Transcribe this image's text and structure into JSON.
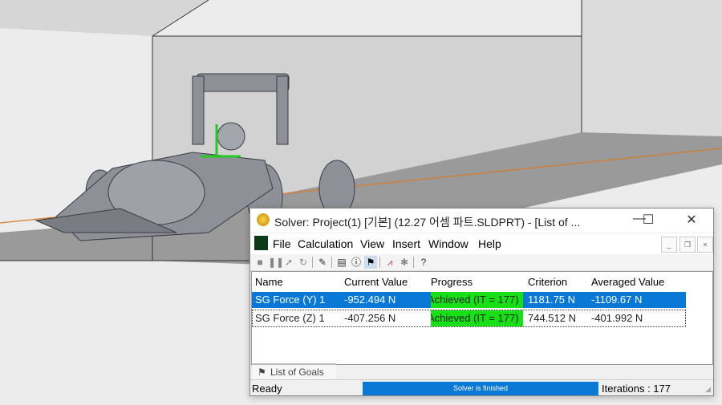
{
  "window": {
    "title": "Solver: Project(1) [기본] (12.27 어셈 파트.SLDPRT) - [List of ...",
    "minimize": "—",
    "maximize": "☐",
    "close": "✕"
  },
  "menu": [
    "File",
    "Calculation",
    "View",
    "Insert",
    "Window",
    "Help"
  ],
  "mdi": {
    "minimize": "_",
    "restore": "❐",
    "close": "×"
  },
  "toolbar": [
    "stop-icon",
    "pause-icon",
    "solve-icon",
    "refresh-icon",
    "pin-icon",
    "document-icon",
    "info-icon",
    "goals-flag-icon",
    "plot-icon",
    "probe-icon",
    "help-icon"
  ],
  "table": {
    "columns": [
      "Name",
      "Current Value",
      "Progress",
      "Criterion",
      "Averaged Value"
    ],
    "rows": [
      {
        "name": "SG Force (Y) 1",
        "current": "-952.494 N",
        "progress": "Achieved (IT = 177)",
        "criterion": "1181.75 N",
        "averaged": "-1109.67 N",
        "selected": true
      },
      {
        "name": "SG Force (Z) 1",
        "current": "-407.256 N",
        "progress": "Achieved (IT = 177)",
        "criterion": "744.512 N",
        "averaged": "-401.992 N",
        "selected": false
      }
    ]
  },
  "tab": {
    "label": "List of Goals"
  },
  "status": {
    "left": "Ready",
    "progress_text": "Solver is finished",
    "progress": 1.0,
    "iterations": "Iterations : 177"
  },
  "colors": {
    "selection": "#0a78d7",
    "achieved": "#17e017"
  }
}
